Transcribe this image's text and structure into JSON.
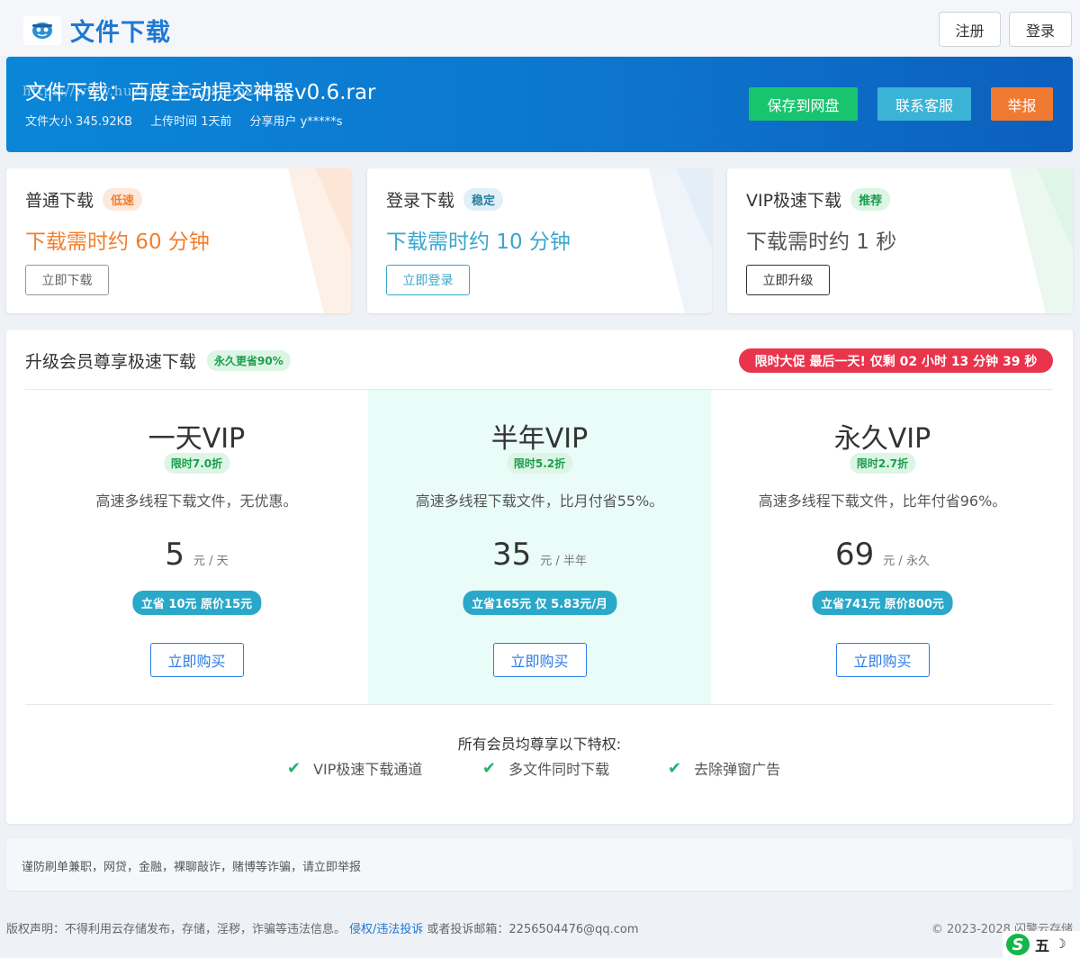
{
  "header": {
    "logo_text": "文件下载",
    "register": "注册",
    "login": "登录"
  },
  "file": {
    "title": "文件下载：百度主动提交神器v0.6.rar",
    "watermark": "https://www.huzhan.com/ishop26271",
    "size": "文件大小 345.92KB",
    "upload_time": "上传时间 1天前",
    "share_user": "分享用户 y*****s",
    "save_label": "保存到网盘",
    "contact_label": "联系客服",
    "report_label": "举报"
  },
  "download_options": [
    {
      "title": "普通下载",
      "tag": "低速",
      "time": "下载需时约 60 分钟",
      "button": "立即下载"
    },
    {
      "title": "登录下载",
      "tag": "稳定",
      "time": "下载需时约 10 分钟",
      "button": "立即登录"
    },
    {
      "title": "VIP极速下载",
      "tag": "推荐",
      "time": "下载需时约 1 秒",
      "button": "立即升级"
    }
  ],
  "vip": {
    "title": "升级会员尊享极速下载",
    "title_tag": "永久更省90%",
    "promo": "限时大促 最后一天! 仅剩 02 小时 13 分钟 39 秒",
    "plans": [
      {
        "name": "一天VIP",
        "discount": "限时7.0折",
        "desc": "高速多线程下载文件，无优惠。",
        "price": "5",
        "unit": "元 / 天",
        "save": "立省 10元 原价15元",
        "buy": "立即购买"
      },
      {
        "name": "半年VIP",
        "discount": "限时5.2折",
        "desc": "高速多线程下载文件，比月付省55%。",
        "price": "35",
        "unit": "元 / 半年",
        "save": "立省165元 仅 5.83元/月",
        "buy": "立即购买"
      },
      {
        "name": "永久VIP",
        "discount": "限时2.7折",
        "desc": "高速多线程下载文件，比年付省96%。",
        "price": "69",
        "unit": "元 / 永久",
        "save": "立省741元 原价800元",
        "buy": "立即购买"
      }
    ],
    "privileges_title": "所有会员均尊享以下特权:",
    "privileges": [
      "VIP极速下载通道",
      "多文件同时下载",
      "去除弹窗广告"
    ]
  },
  "notice": "谨防刷单兼职，网贷，金融，裸聊敲诈，赌博等诈骗，请立即举报",
  "footer": {
    "copyright_text": "版权声明：不得利用云存储发布，存储，淫秽，诈骗等违法信息。",
    "report_link": "侵权/违法投诉",
    "email_text": "或者投诉邮箱：2256504476@qq.com",
    "right_text": "© 2023-2028 闪警云存储"
  },
  "ime": {
    "logo": "S",
    "mode": "五",
    "moon": "☽"
  },
  "colors": {
    "brand": "#1f78d1",
    "banner": "#0d74cc",
    "slow": "#f07f2e",
    "stable": "#3ba6cc",
    "green": "#18c56e",
    "promo": "#e9344b"
  }
}
